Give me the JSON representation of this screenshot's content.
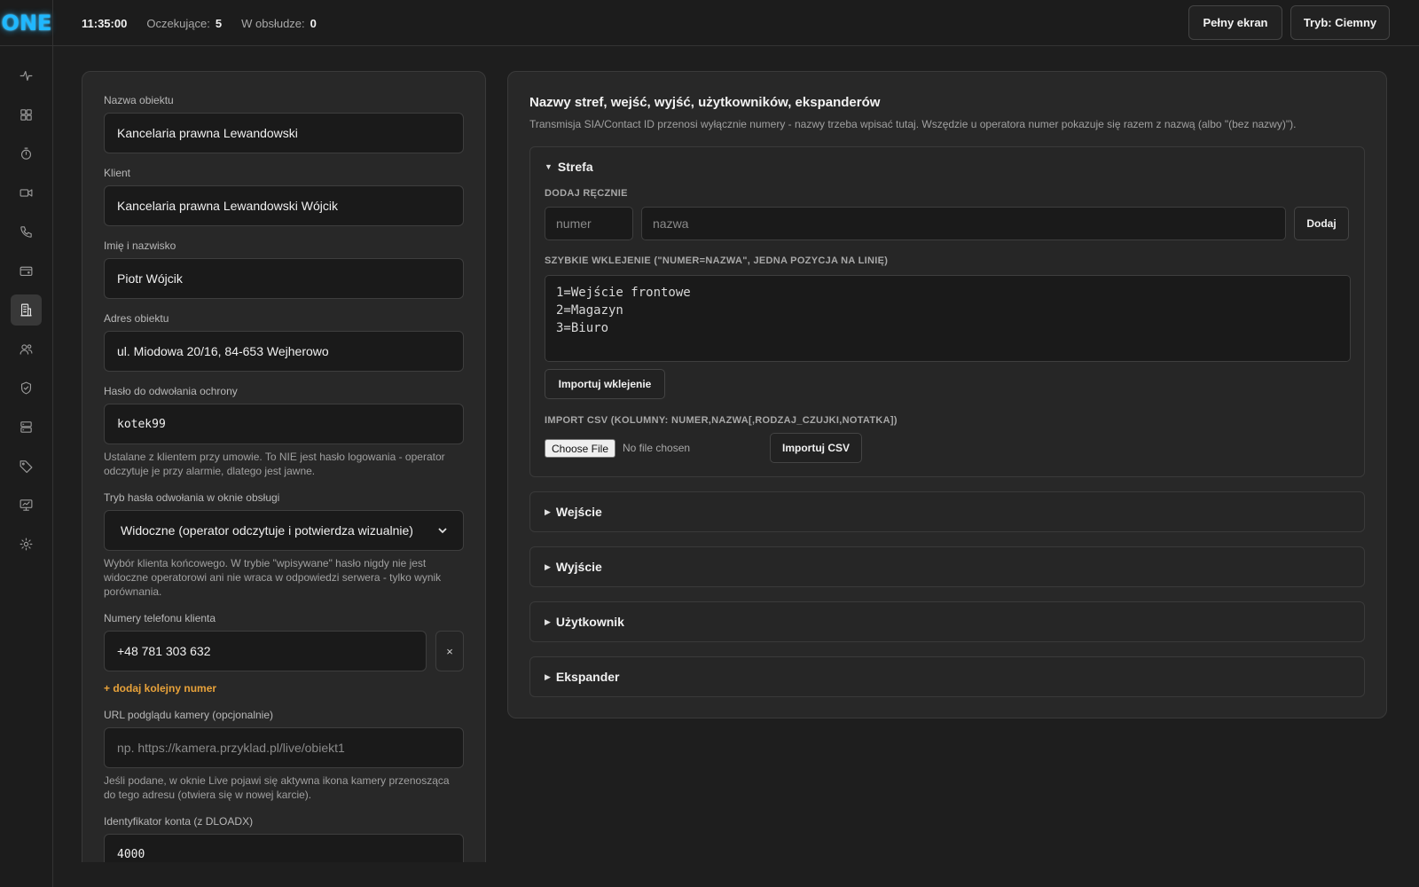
{
  "logo": "ONE",
  "topbar": {
    "time": "11:35:00",
    "pending_label": "Oczekujące:",
    "pending_value": "5",
    "in_service_label": "W obsłudze:",
    "in_service_value": "0",
    "fullscreen_label": "Pełny ekran",
    "theme_label": "Tryb: Ciemny"
  },
  "sidebar": {
    "items": [
      {
        "icon": "activity-icon"
      },
      {
        "icon": "dashboard-grid-icon"
      },
      {
        "icon": "timer-icon"
      },
      {
        "icon": "video-camera-icon"
      },
      {
        "icon": "phone-icon"
      },
      {
        "icon": "wallet-icon"
      },
      {
        "icon": "building-report-icon",
        "active": true
      },
      {
        "icon": "users-icon"
      },
      {
        "icon": "shield-check-icon"
      },
      {
        "icon": "server-icon"
      },
      {
        "icon": "tag-icon"
      },
      {
        "icon": "monitor-icon"
      },
      {
        "icon": "settings-sun-icon"
      }
    ]
  },
  "form": {
    "object_name": {
      "label": "Nazwa obiektu",
      "value": "Kancelaria prawna Lewandowski"
    },
    "client": {
      "label": "Klient",
      "value": "Kancelaria prawna Lewandowski Wójcik"
    },
    "full_name": {
      "label": "Imię i nazwisko",
      "value": "Piotr Wójcik"
    },
    "address": {
      "label": "Adres obiektu",
      "value": "ul. Miodowa 20/16, 84-653 Wejherowo"
    },
    "password": {
      "label": "Hasło do odwołania ochrony",
      "value": "kotek99",
      "help": "Ustalane z klientem przy umowie. To NIE jest hasło logowania - operator odczytuje je przy alarmie, dlatego jest jawne."
    },
    "password_mode": {
      "label": "Tryb hasła odwołania w oknie obsługi",
      "value": "Widoczne (operator odczytuje i potwierdza wizualnie)",
      "help": "Wybór klienta końcowego. W trybie \"wpisywane\" hasło nigdy nie jest widoczne operatorowi ani nie wraca w odpowiedzi serwera - tylko wynik porównania."
    },
    "phones": {
      "label": "Numery telefonu klienta",
      "values": [
        "+48 781 303 632"
      ],
      "remove_label": "×",
      "add_label": "+ dodaj kolejny numer"
    },
    "camera_url": {
      "label": "URL podglądu kamery (opcjonalnie)",
      "placeholder": "np. https://kamera.przyklad.pl/live/obiekt1",
      "help": "Jeśli podane, w oknie Live pojawi się aktywna ikona kamery przenosząca do tego adresu (otwiera się w nowej karcie)."
    },
    "account_id": {
      "label": "Identyfikator konta (z DLOADX)",
      "value": "4000"
    }
  },
  "names": {
    "title": "Nazwy stref, wejść, wyjść, użytkowników, ekspanderów",
    "subtitle": "Transmisja SIA/Contact ID przenosi wyłącznie numery - nazwy trzeba wpisać tutaj. Wszędzie u operatora numer pokazuje się razem z nazwą (albo \"(bez nazwy)\").",
    "zone": {
      "header": "Strefa",
      "expanded": true,
      "add_manual_caption": "DODAJ RĘCZNIE",
      "number_placeholder": "numer",
      "name_placeholder": "nazwa",
      "add_button": "Dodaj",
      "paste_caption": "SZYBKIE WKLEJENIE (\"NUMER=NAZWA\", JEDNA POZYCJA NA LINIĘ)",
      "paste_lines": [
        "1=Wejście frontowe",
        "2=Magazyn",
        "3=Biuro"
      ],
      "import_paste_button": "Importuj wklejenie",
      "csv_caption": "IMPORT CSV (KOLUMNY: NUMER,NAZWA[,RODZAJ_CZUJKI,NOTATKA])",
      "choose_file": "Choose File",
      "no_file": "No file chosen",
      "import_csv_button": "Importuj CSV"
    },
    "collapsed_sections": [
      "Wejście",
      "Wyjście",
      "Użytkownik",
      "Ekspander"
    ]
  },
  "colors": {
    "accent_logo": "#1fb8ff",
    "link": "#e8a23a",
    "background": "#1e1e1e",
    "panel": "#282828"
  }
}
